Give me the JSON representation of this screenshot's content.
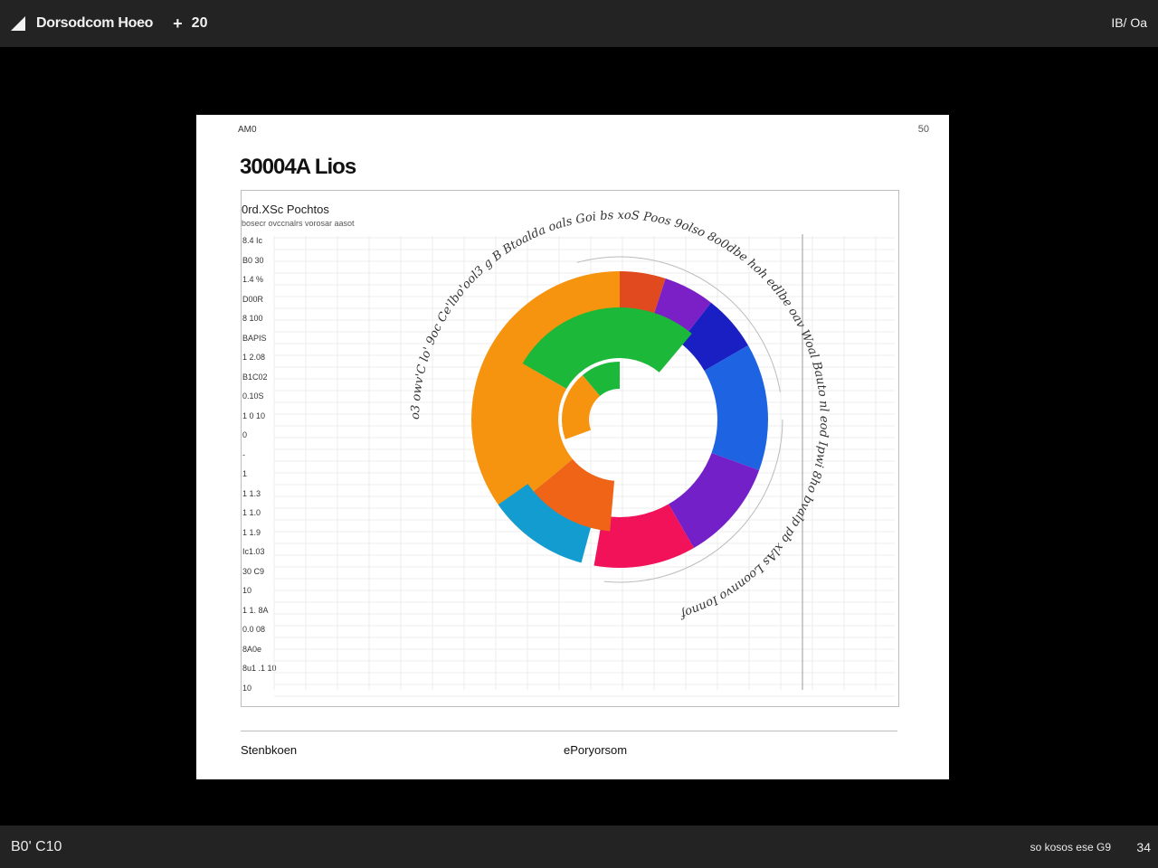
{
  "app": {
    "title": "Dorsodcom Hoeo",
    "add_label": "+",
    "count": "20",
    "right_label": "IB/ Oa"
  },
  "status": {
    "left": "B0' C10",
    "right_text": "so kosos ese G9",
    "right_num": "34"
  },
  "card": {
    "tag": "AM0",
    "corner": "50",
    "title": "30004A Lios",
    "footer_left": "Stenbkoen",
    "footer_right": "ePoryorsom"
  },
  "chart_data": {
    "type": "pie",
    "title": "0rd.XSc Pochtos",
    "subtitle": "bosecr ovccnalrs vorosar aasot",
    "y_tick_labels": [
      "8.4 Ic",
      "B0 30",
      "1.4 %",
      "D00R",
      "8 100",
      "BAPIS",
      "1 2.08",
      "B1C02",
      "0.10S",
      "1 0 10",
      "0",
      "-",
      "1",
      "1 1.3",
      "1 1.0",
      "1 1.9",
      "Ic1.03",
      "30 C9",
      "10",
      "1 1. 8A",
      "0.0 08",
      "8A0e",
      "8u1 .1 10",
      "10"
    ],
    "slices": [
      {
        "label": "orange",
        "color": "#f7940f",
        "ring": "outer",
        "start": 215,
        "end": 360
      },
      {
        "label": "red",
        "color": "#e04a1e",
        "ring": "outer",
        "start": 0,
        "end": 18
      },
      {
        "label": "violet",
        "color": "#7b1fc7",
        "ring": "outer",
        "start": 18,
        "end": 38
      },
      {
        "label": "dark-blue",
        "color": "#1a1fc4",
        "ring": "outer",
        "start": 38,
        "end": 60
      },
      {
        "label": "blue",
        "color": "#1e63e2",
        "ring": "outer",
        "start": 60,
        "end": 110
      },
      {
        "label": "purple",
        "color": "#7420c8",
        "ring": "outer",
        "start": 110,
        "end": 150
      },
      {
        "label": "pink",
        "color": "#f2125a",
        "ring": "outer",
        "start": 150,
        "end": 190
      },
      {
        "label": "teal",
        "color": "#139ccf",
        "ring": "outer",
        "start": 195,
        "end": 235
      },
      {
        "label": "green",
        "color": "#1cb83a",
        "ring": "inner",
        "start": 300,
        "end": 400
      },
      {
        "label": "orange-inner",
        "color": "#f7940f",
        "ring": "inner",
        "start": 230,
        "end": 300
      },
      {
        "label": "orange-red-inner",
        "color": "#f06418",
        "ring": "inner",
        "start": 185,
        "end": 230
      },
      {
        "label": "small-green",
        "color": "#1cb83a",
        "ring": "core",
        "start": 320,
        "end": 360
      },
      {
        "label": "small-orange",
        "color": "#f7940f",
        "ring": "core",
        "start": 250,
        "end": 320
      }
    ],
    "ring_text": "o3 owv'C lo' 9oc Ce'lbo'ool3 g B Btoalda oals Goi bs xoS Poos 9olso 8o0dbe hoh edlbe oav Woal Bauto nl eod Ipwi 8ho bvalp pb xlAs Loonnvo Ionnof"
  }
}
